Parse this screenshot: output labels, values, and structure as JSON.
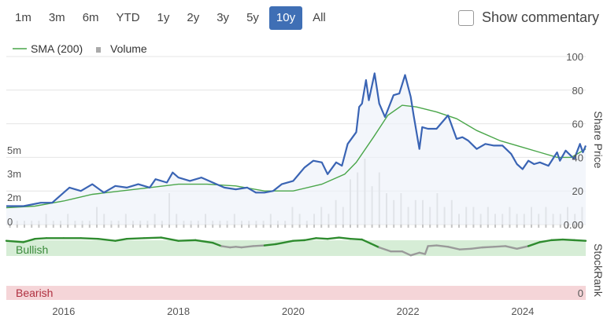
{
  "toolbar": {
    "ranges": [
      "1m",
      "3m",
      "6m",
      "YTD",
      "1y",
      "2y",
      "3y",
      "5y",
      "10y",
      "All"
    ],
    "active_range": "10y",
    "commentary_label": "Show commentary"
  },
  "colors": {
    "price_line": "#3a64b4",
    "sma_line": "#4aa64a",
    "volume_bar": "#c4c4c4",
    "bullish_band": "#d6edd6",
    "bearish_band": "#f5d5d8",
    "rank_high": "#2e8b2e",
    "rank_low": "#9a9a9a",
    "active_button": "#3f6fb5"
  },
  "chart_data": {
    "type": "line",
    "legend": {
      "position": "top-left",
      "entries": [
        "SMA (200)",
        "Volume"
      ]
    },
    "x_ticks": [
      "2016",
      "2018",
      "2020",
      "2022",
      "2024"
    ],
    "x_range": [
      2015.0,
      2025.1
    ],
    "price_axis": {
      "title": "Share Price",
      "ticks": [
        "100",
        "80",
        "60",
        "40",
        "20",
        "0.00"
      ],
      "ylim": [
        0,
        100
      ]
    },
    "volume_axis": {
      "ticks": [
        "5m",
        "3m",
        "2m",
        "0"
      ]
    },
    "series": [
      {
        "name": "Share Price",
        "points": [
          [
            2015.0,
            11
          ],
          [
            2015.3,
            11
          ],
          [
            2015.6,
            13
          ],
          [
            2015.8,
            13
          ],
          [
            2016.0,
            19
          ],
          [
            2016.1,
            22
          ],
          [
            2016.3,
            20
          ],
          [
            2016.5,
            24
          ],
          [
            2016.7,
            19
          ],
          [
            2016.9,
            23
          ],
          [
            2017.1,
            22
          ],
          [
            2017.3,
            24
          ],
          [
            2017.5,
            22
          ],
          [
            2017.6,
            27
          ],
          [
            2017.8,
            25
          ],
          [
            2017.9,
            31
          ],
          [
            2018.0,
            28
          ],
          [
            2018.2,
            26
          ],
          [
            2018.4,
            28
          ],
          [
            2018.6,
            25
          ],
          [
            2018.8,
            22
          ],
          [
            2019.0,
            21
          ],
          [
            2019.2,
            22
          ],
          [
            2019.35,
            19
          ],
          [
            2019.5,
            19
          ],
          [
            2019.65,
            20
          ],
          [
            2019.8,
            24
          ],
          [
            2020.0,
            26
          ],
          [
            2020.2,
            34
          ],
          [
            2020.35,
            38
          ],
          [
            2020.5,
            37
          ],
          [
            2020.6,
            30
          ],
          [
            2020.75,
            37
          ],
          [
            2020.85,
            35
          ],
          [
            2020.95,
            48
          ],
          [
            2021.1,
            55
          ],
          [
            2021.15,
            70
          ],
          [
            2021.2,
            72
          ],
          [
            2021.27,
            86
          ],
          [
            2021.32,
            74
          ],
          [
            2021.42,
            90
          ],
          [
            2021.5,
            72
          ],
          [
            2021.6,
            64
          ],
          [
            2021.75,
            77
          ],
          [
            2021.85,
            78
          ],
          [
            2021.95,
            89
          ],
          [
            2022.05,
            76
          ],
          [
            2022.1,
            65
          ],
          [
            2022.2,
            45
          ],
          [
            2022.25,
            58
          ],
          [
            2022.35,
            57
          ],
          [
            2022.5,
            57
          ],
          [
            2022.7,
            65
          ],
          [
            2022.85,
            51
          ],
          [
            2022.95,
            52
          ],
          [
            2023.05,
            50
          ],
          [
            2023.2,
            45
          ],
          [
            2023.35,
            48
          ],
          [
            2023.5,
            47
          ],
          [
            2023.65,
            47
          ],
          [
            2023.8,
            42
          ],
          [
            2023.9,
            36
          ],
          [
            2024.0,
            33
          ],
          [
            2024.1,
            38
          ],
          [
            2024.2,
            36
          ],
          [
            2024.3,
            37
          ],
          [
            2024.45,
            35
          ],
          [
            2024.6,
            43
          ],
          [
            2024.65,
            38
          ],
          [
            2024.75,
            44
          ],
          [
            2024.9,
            39
          ],
          [
            2025.0,
            48
          ],
          [
            2025.05,
            43
          ],
          [
            2025.1,
            47
          ]
        ]
      },
      {
        "name": "SMA (200)",
        "points": [
          [
            2015.0,
            10
          ],
          [
            2015.5,
            11
          ],
          [
            2016.0,
            14
          ],
          [
            2016.5,
            18
          ],
          [
            2017.0,
            20
          ],
          [
            2017.5,
            22
          ],
          [
            2018.0,
            24
          ],
          [
            2018.5,
            24
          ],
          [
            2019.0,
            23
          ],
          [
            2019.5,
            20
          ],
          [
            2020.0,
            20
          ],
          [
            2020.5,
            24
          ],
          [
            2020.9,
            30
          ],
          [
            2021.1,
            37
          ],
          [
            2021.4,
            52
          ],
          [
            2021.65,
            65
          ],
          [
            2021.9,
            71
          ],
          [
            2022.15,
            70
          ],
          [
            2022.5,
            67
          ],
          [
            2022.85,
            63
          ],
          [
            2023.2,
            56
          ],
          [
            2023.6,
            50
          ],
          [
            2024.0,
            46
          ],
          [
            2024.3,
            43
          ],
          [
            2024.6,
            40
          ],
          [
            2024.85,
            40
          ],
          [
            2025.1,
            45
          ]
        ]
      },
      {
        "name": "Volume",
        "values": [
          1,
          1,
          1,
          1,
          1,
          2,
          1,
          1,
          2,
          1,
          1,
          1,
          3,
          2,
          1,
          1,
          2,
          1,
          1,
          1,
          2,
          1,
          5,
          2,
          1,
          1,
          1,
          2,
          1,
          1,
          1,
          2,
          1,
          1,
          1,
          1,
          2,
          1,
          1,
          3,
          2,
          1,
          2,
          3,
          2,
          4,
          3,
          7,
          8,
          10,
          6,
          8,
          5,
          4,
          5,
          3,
          4,
          4,
          3,
          5,
          3,
          4,
          2,
          3,
          3,
          2,
          3,
          2,
          2,
          3,
          2,
          2,
          3,
          2,
          3,
          2,
          2,
          3,
          2,
          3
        ]
      }
    ],
    "stockrank": {
      "title": "StockRank",
      "bands": {
        "top": "Bullish",
        "bottom": "Bearish"
      },
      "bottom_value": "0",
      "points": [
        [
          2015.0,
          92
        ],
        [
          2015.3,
          90
        ],
        [
          2015.5,
          95
        ],
        [
          2015.7,
          96
        ],
        [
          2016.0,
          96
        ],
        [
          2016.3,
          96
        ],
        [
          2016.6,
          95
        ],
        [
          2016.9,
          92
        ],
        [
          2017.1,
          95
        ],
        [
          2017.4,
          96
        ],
        [
          2017.7,
          97
        ],
        [
          2018.0,
          92
        ],
        [
          2018.3,
          93
        ],
        [
          2018.6,
          89
        ],
        [
          2018.75,
          84
        ],
        [
          2018.9,
          82
        ],
        [
          2019.0,
          83
        ],
        [
          2019.1,
          82
        ],
        [
          2019.3,
          84
        ],
        [
          2019.5,
          85
        ],
        [
          2019.7,
          87
        ],
        [
          2020.0,
          92
        ],
        [
          2020.2,
          93
        ],
        [
          2020.4,
          96
        ],
        [
          2020.6,
          95
        ],
        [
          2020.8,
          97
        ],
        [
          2021.0,
          95
        ],
        [
          2021.2,
          94
        ],
        [
          2021.35,
          88
        ],
        [
          2021.5,
          82
        ],
        [
          2021.7,
          76
        ],
        [
          2021.9,
          76
        ],
        [
          2022.05,
          70
        ],
        [
          2022.2,
          74
        ],
        [
          2022.3,
          72
        ],
        [
          2022.35,
          84
        ],
        [
          2022.5,
          85
        ],
        [
          2022.7,
          83
        ],
        [
          2022.9,
          79
        ],
        [
          2023.1,
          80
        ],
        [
          2023.3,
          82
        ],
        [
          2023.5,
          83
        ],
        [
          2023.7,
          84
        ],
        [
          2023.9,
          80
        ],
        [
          2024.1,
          84
        ],
        [
          2024.3,
          90
        ],
        [
          2024.5,
          93
        ],
        [
          2024.7,
          94
        ],
        [
          2024.9,
          93
        ],
        [
          2025.1,
          92
        ]
      ],
      "threshold": 85
    }
  }
}
